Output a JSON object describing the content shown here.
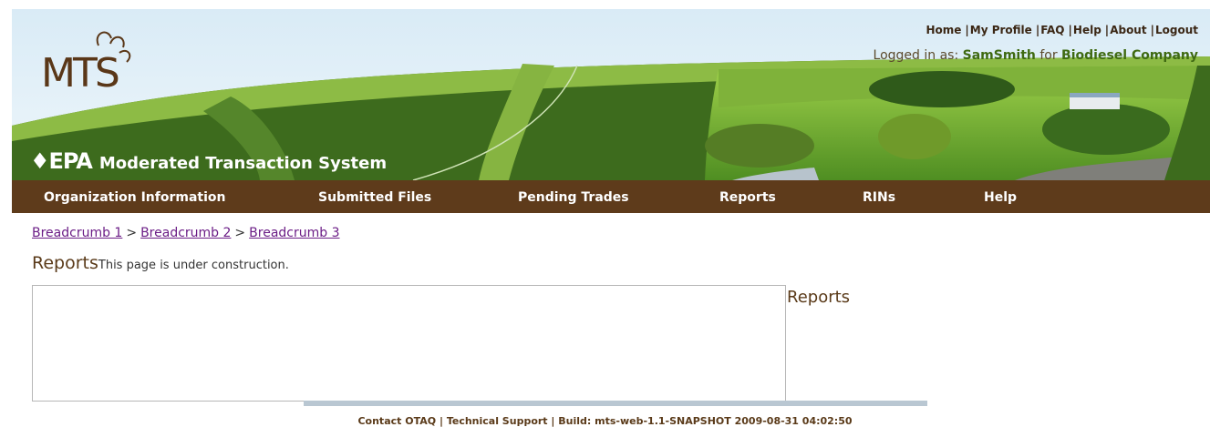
{
  "header": {
    "logo_text": "MTS",
    "epa_mark": "EPA",
    "system_name": "Moderated Transaction System",
    "top_links": [
      "Home",
      "My Profile",
      "FAQ",
      "Help",
      "About",
      "Logout"
    ],
    "login_prefix": "Logged in as:",
    "user": "SamSmith",
    "for_word": "for",
    "company": "Biodiesel Company"
  },
  "nav": {
    "items": [
      "Organization Information",
      "Submitted Files",
      "Pending Trades",
      "Reports",
      "RINs",
      "Help"
    ]
  },
  "breadcrumb": [
    "Breadcrumb 1",
    "Breadcrumb 2",
    "Breadcrumb 3"
  ],
  "breadcrumb_sep": ">",
  "main": {
    "title": "Reports",
    "construction_text": "This page is under construction.",
    "side_title": "Reports"
  },
  "footer": {
    "contact": "Contact OTAQ",
    "sep": "|",
    "support": "Technical Support",
    "build": "Build: mts-web-1.1-SNAPSHOT 2009-08-31 04:02:50"
  },
  "colors": {
    "nav_bg": "#5e3b1b",
    "banner_green": "#3d6b1d",
    "brand_brown": "#5a3a19",
    "link_purple": "#6b1d86"
  }
}
